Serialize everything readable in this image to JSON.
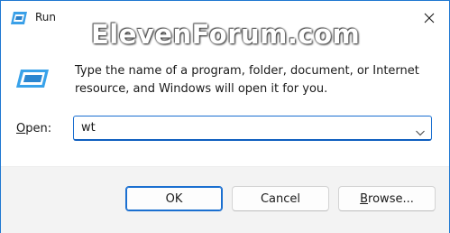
{
  "window": {
    "title": "Run"
  },
  "watermark": "ElevenForum.com",
  "description": {
    "line1": "Type the name of a program, folder, document, or Internet",
    "line2": "resource, and Windows will open it for you."
  },
  "open_field": {
    "label_accel": "O",
    "label_rest": "pen:",
    "value": "wt"
  },
  "buttons": {
    "ok": "OK",
    "cancel": "Cancel",
    "browse_accel": "B",
    "browse_rest": "rowse..."
  },
  "icons": {
    "title": "run-app-icon",
    "close": "close-icon",
    "run": "run-app-icon",
    "dropdown": "chevron-down-icon"
  },
  "colors": {
    "accent": "#1a6fd0",
    "frame": "#1f78d1",
    "footer": "#f3f3f3"
  }
}
